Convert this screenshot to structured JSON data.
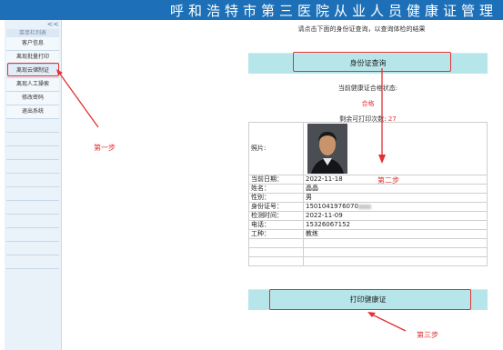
{
  "header": {
    "title": "呼和浩特市第三医院从业人员健康证管理"
  },
  "sidebar": {
    "collapse": "<<",
    "heading": "菜单栏列表",
    "items": [
      {
        "label": "客户信息"
      },
      {
        "label": "离现批量打印"
      },
      {
        "label": "离现云储制证"
      },
      {
        "label": "离现人工操索"
      },
      {
        "label": "修改密码"
      },
      {
        "label": "退出系统"
      }
    ]
  },
  "main": {
    "instruction": "请点击下面的身份证查询，以查询体检的结果",
    "query_button": "身份证查询",
    "status_label": "当前健康证合格状态:",
    "status_value": "合格",
    "remaining_label": "剩余可打印次数:",
    "remaining_value": "27",
    "photo_label": "照片:",
    "rows": [
      {
        "label": "当前日期：",
        "value": "2022-11-18"
      },
      {
        "label": "姓名：",
        "value": "晶晶"
      },
      {
        "label": "性别：",
        "value": "男"
      },
      {
        "label": "身份证号：",
        "value": "1501041976070"
      },
      {
        "label": "检测时间：",
        "value": "2022-11-09"
      },
      {
        "label": "电话：",
        "value": "15326067152"
      },
      {
        "label": "工种：",
        "value": "教练"
      }
    ],
    "print_button": "打印健康证"
  },
  "annotations": {
    "step1": "第一步",
    "step2": "第二步",
    "step3": "第三步"
  },
  "colors": {
    "banner": "#1d70b7",
    "bar": "#b7e6ea",
    "highlight": "#e23131"
  }
}
